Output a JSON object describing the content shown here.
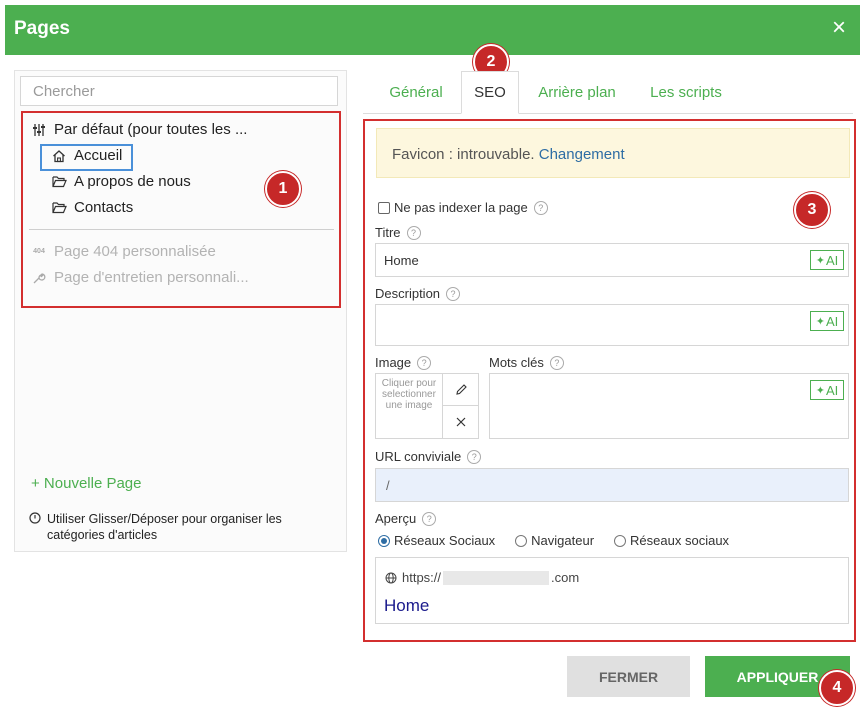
{
  "dialog": {
    "title": "Pages",
    "close_label": "×"
  },
  "left": {
    "search_placeholder": "Chercher",
    "tree": [
      {
        "label": "Par défaut (pour toutes les ...",
        "icon": "sliders-icon"
      },
      {
        "label": "Accueil",
        "icon": "home-icon",
        "selected": true
      },
      {
        "label": "A propos de nous",
        "icon": "folder-open-icon"
      },
      {
        "label": "Contacts",
        "icon": "folder-open-icon"
      }
    ],
    "special": [
      {
        "label": "Page 404 personnalisée",
        "icon": "404-icon"
      },
      {
        "label": "Page d'entretien personnali...",
        "icon": "wrench-icon"
      }
    ],
    "new_page": "+ Nouvelle Page",
    "hint": "Utiliser Glisser/Déposer pour organiser les catégories d'articles"
  },
  "badges": {
    "b1": "1",
    "b2": "2",
    "b3": "3",
    "b4": "4"
  },
  "tabs": [
    {
      "label": "Général",
      "active": false
    },
    {
      "label": "SEO",
      "active": true
    },
    {
      "label": "Arrière plan",
      "active": false
    },
    {
      "label": "Les scripts",
      "active": false
    }
  ],
  "seo": {
    "favicon_text": "Favicon : introuvable.",
    "favicon_link": "Changement",
    "noindex_label": "Ne pas indexer la page",
    "title_label": "Titre",
    "title_value": "Home",
    "description_label": "Description",
    "description_value": "",
    "image_label": "Image",
    "image_placeholder": "Cliquer pour selectionner une image",
    "keywords_label": "Mots clés",
    "keywords_value": "",
    "ai_label": "AI",
    "url_label": "URL conviviale",
    "url_value": "/",
    "preview_label": "Aperçu",
    "preview_options": [
      "Réseaux Sociaux",
      "Navigateur",
      "Réseaux sociaux"
    ],
    "preview_selected": "Réseaux Sociaux",
    "preview_url_prefix": "https://",
    "preview_url_suffix": ".com",
    "preview_title": "Home"
  },
  "buttons": {
    "close": "FERMER",
    "apply": "APPLIQUER"
  },
  "colors": {
    "header": "#4caf50",
    "accent": "#4caf50",
    "highlight": "#d32f2f",
    "link": "#2e6da4"
  }
}
